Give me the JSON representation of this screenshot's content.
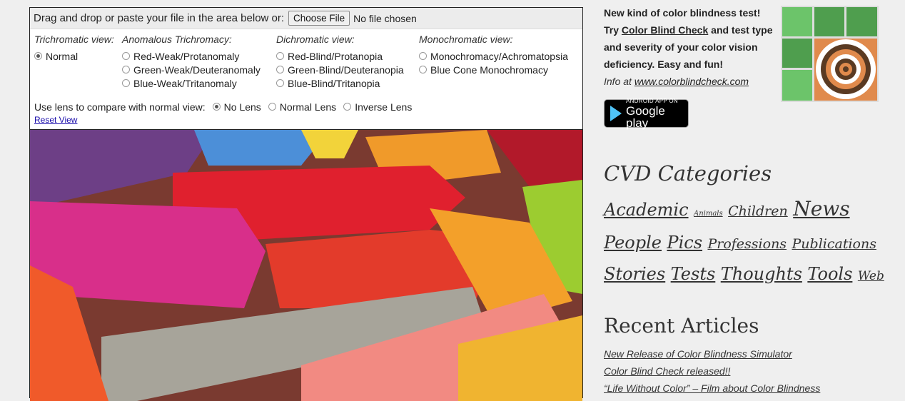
{
  "simulator": {
    "drop_label": "Drag and drop or paste your file in the area below or:",
    "choose_file_label": "Choose File",
    "file_status": "No file chosen",
    "columns": [
      {
        "title": "Trichromatic view:",
        "options": [
          {
            "label": "Normal",
            "checked": true
          }
        ]
      },
      {
        "title": "Anomalous Trichromacy:",
        "options": [
          {
            "label": "Red-Weak/Protanomaly",
            "checked": false
          },
          {
            "label": "Green-Weak/Deuteranomaly",
            "checked": false
          },
          {
            "label": "Blue-Weak/Tritanomaly",
            "checked": false
          }
        ]
      },
      {
        "title": "Dichromatic view:",
        "options": [
          {
            "label": "Red-Blind/Protanopia",
            "checked": false
          },
          {
            "label": "Green-Blind/Deuteranopia",
            "checked": false
          },
          {
            "label": "Blue-Blind/Tritanopia",
            "checked": false
          }
        ]
      },
      {
        "title": "Monochromatic view:",
        "options": [
          {
            "label": "Monochromacy/Achromatopsia",
            "checked": false
          },
          {
            "label": "Blue Cone Monochromacy",
            "checked": false
          }
        ]
      }
    ],
    "lens_label": "Use lens to compare with normal view:",
    "lens_options": [
      {
        "label": "No Lens",
        "checked": true
      },
      {
        "label": "Normal Lens",
        "checked": false
      },
      {
        "label": "Inverse Lens",
        "checked": false
      }
    ],
    "reset_label": "Reset View",
    "image_description": "Close-up photo of colorful wax crayons"
  },
  "sidebar": {
    "promo": {
      "line1": "New kind of color blindness test!",
      "try": "Try ",
      "link": "Color Blind Check",
      "rest": " and test type and severity of your color vision deficiency. Easy and fun!",
      "info_prefix": "Info at ",
      "info_link": "www.colorblindcheck.com"
    },
    "google_play": {
      "small": "ANDROID APP ON",
      "big": "Google play"
    },
    "cvd_title": "CVD Categories",
    "tags": [
      {
        "label": "Academic",
        "size": "l"
      },
      {
        "label": "Animals",
        "size": "xs"
      },
      {
        "label": "Children",
        "size": "m"
      },
      {
        "label": "News",
        "size": "xl"
      },
      {
        "label": "People",
        "size": "l"
      },
      {
        "label": "Pics",
        "size": "l"
      },
      {
        "label": "Professions",
        "size": "m"
      },
      {
        "label": "Publications",
        "size": "m"
      },
      {
        "label": "Stories",
        "size": "l"
      },
      {
        "label": "Tests",
        "size": "l"
      },
      {
        "label": "Thoughts",
        "size": "l"
      },
      {
        "label": "Tools",
        "size": "l"
      },
      {
        "label": "Web",
        "size": "s"
      }
    ],
    "recent_title": "Recent Articles",
    "recent": [
      "New Release of Color Blindness Simulator",
      "Color Blind Check released!!",
      "“Life Without Color” – Film about Color Blindness"
    ]
  },
  "colors": {
    "app_icon_green": "#6cc46a",
    "app_icon_dark_green": "#4f9e4e",
    "app_icon_orange": "#e08a4c",
    "app_icon_brown": "#5a3a22"
  }
}
